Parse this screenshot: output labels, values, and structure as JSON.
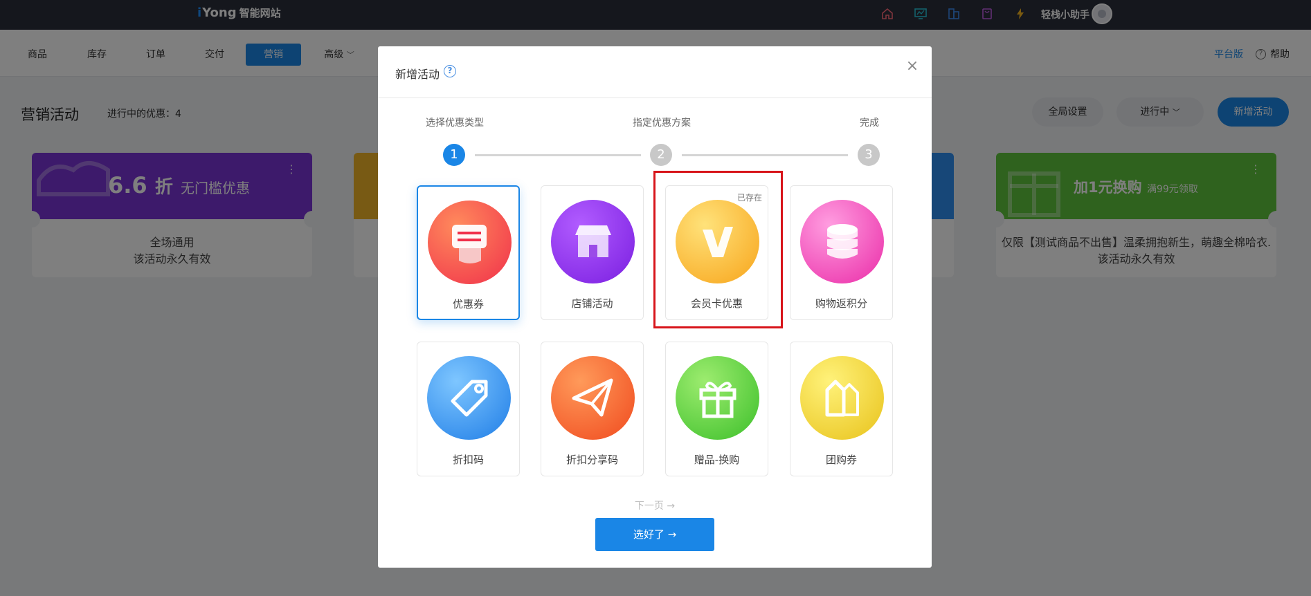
{
  "brand": {
    "prefix": "i",
    "name": "Yong",
    "sub": "智能网站"
  },
  "topbar": {
    "icons": [
      "home-icon",
      "monitor-icon",
      "building-icon",
      "bag-icon",
      "lightning-icon"
    ],
    "user_name": "轻栈小助手"
  },
  "nav": {
    "items": [
      "商品",
      "库存",
      "订单",
      "交付",
      "营销",
      "高级"
    ],
    "active": "营销",
    "platform": "平台版",
    "help": "帮助"
  },
  "page": {
    "title": "营销活动",
    "ongoing_count": "进行中的优惠：4",
    "global_settings": "全局设置",
    "status_filter": "进行中",
    "new_activity": "新增活动"
  },
  "cards": [
    {
      "head_big": "6.6",
      "head_unit": "折",
      "head_text": "无门槛优惠",
      "line1": "全场通用",
      "line2": "该活动永久有效",
      "color": "#7a35d6"
    },
    {
      "head_big": "加1元换购",
      "head_text": "满99元领取",
      "line1": "仅限【测试商品不出售】温柔拥抱新生，萌趣全棉哈衣...",
      "line2": "该活动永久有效",
      "color": "#5ec53c"
    }
  ],
  "modal": {
    "title": "新增活动",
    "help_icon": "?",
    "close": "×",
    "steps": [
      {
        "num": "1",
        "label": "选择优惠类型"
      },
      {
        "num": "2",
        "label": "指定优惠方案"
      },
      {
        "num": "3",
        "label": "完成"
      }
    ],
    "options": [
      {
        "label": "优惠券",
        "icon": "coupon-icon"
      },
      {
        "label": "店铺活动",
        "icon": "store-icon"
      },
      {
        "label": "会员卡优惠",
        "icon": "vip-card-icon",
        "tag": "已存在"
      },
      {
        "label": "购物返积分",
        "icon": "points-icon"
      },
      {
        "label": "折扣码",
        "icon": "discount-tag-icon"
      },
      {
        "label": "折扣分享码",
        "icon": "paper-plane-icon"
      },
      {
        "label": "赠品-换购",
        "icon": "gift-icon"
      },
      {
        "label": "团购券",
        "icon": "group-ticket-icon"
      }
    ],
    "selected": "优惠券",
    "next_page": "下一页 →",
    "confirm": "选好了 →"
  }
}
